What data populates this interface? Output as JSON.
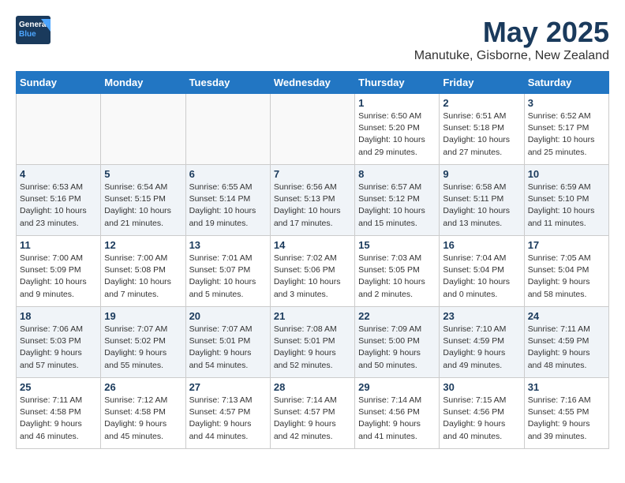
{
  "header": {
    "logo_general": "General",
    "logo_blue": "Blue",
    "month_title": "May 2025",
    "location": "Manutuke, Gisborne, New Zealand"
  },
  "weekdays": [
    "Sunday",
    "Monday",
    "Tuesday",
    "Wednesday",
    "Thursday",
    "Friday",
    "Saturday"
  ],
  "weeks": [
    [
      {
        "day": "",
        "info": ""
      },
      {
        "day": "",
        "info": ""
      },
      {
        "day": "",
        "info": ""
      },
      {
        "day": "",
        "info": ""
      },
      {
        "day": "1",
        "info": "Sunrise: 6:50 AM\nSunset: 5:20 PM\nDaylight: 10 hours\nand 29 minutes."
      },
      {
        "day": "2",
        "info": "Sunrise: 6:51 AM\nSunset: 5:18 PM\nDaylight: 10 hours\nand 27 minutes."
      },
      {
        "day": "3",
        "info": "Sunrise: 6:52 AM\nSunset: 5:17 PM\nDaylight: 10 hours\nand 25 minutes."
      }
    ],
    [
      {
        "day": "4",
        "info": "Sunrise: 6:53 AM\nSunset: 5:16 PM\nDaylight: 10 hours\nand 23 minutes."
      },
      {
        "day": "5",
        "info": "Sunrise: 6:54 AM\nSunset: 5:15 PM\nDaylight: 10 hours\nand 21 minutes."
      },
      {
        "day": "6",
        "info": "Sunrise: 6:55 AM\nSunset: 5:14 PM\nDaylight: 10 hours\nand 19 minutes."
      },
      {
        "day": "7",
        "info": "Sunrise: 6:56 AM\nSunset: 5:13 PM\nDaylight: 10 hours\nand 17 minutes."
      },
      {
        "day": "8",
        "info": "Sunrise: 6:57 AM\nSunset: 5:12 PM\nDaylight: 10 hours\nand 15 minutes."
      },
      {
        "day": "9",
        "info": "Sunrise: 6:58 AM\nSunset: 5:11 PM\nDaylight: 10 hours\nand 13 minutes."
      },
      {
        "day": "10",
        "info": "Sunrise: 6:59 AM\nSunset: 5:10 PM\nDaylight: 10 hours\nand 11 minutes."
      }
    ],
    [
      {
        "day": "11",
        "info": "Sunrise: 7:00 AM\nSunset: 5:09 PM\nDaylight: 10 hours\nand 9 minutes."
      },
      {
        "day": "12",
        "info": "Sunrise: 7:00 AM\nSunset: 5:08 PM\nDaylight: 10 hours\nand 7 minutes."
      },
      {
        "day": "13",
        "info": "Sunrise: 7:01 AM\nSunset: 5:07 PM\nDaylight: 10 hours\nand 5 minutes."
      },
      {
        "day": "14",
        "info": "Sunrise: 7:02 AM\nSunset: 5:06 PM\nDaylight: 10 hours\nand 3 minutes."
      },
      {
        "day": "15",
        "info": "Sunrise: 7:03 AM\nSunset: 5:05 PM\nDaylight: 10 hours\nand 2 minutes."
      },
      {
        "day": "16",
        "info": "Sunrise: 7:04 AM\nSunset: 5:04 PM\nDaylight: 10 hours\nand 0 minutes."
      },
      {
        "day": "17",
        "info": "Sunrise: 7:05 AM\nSunset: 5:04 PM\nDaylight: 9 hours\nand 58 minutes."
      }
    ],
    [
      {
        "day": "18",
        "info": "Sunrise: 7:06 AM\nSunset: 5:03 PM\nDaylight: 9 hours\nand 57 minutes."
      },
      {
        "day": "19",
        "info": "Sunrise: 7:07 AM\nSunset: 5:02 PM\nDaylight: 9 hours\nand 55 minutes."
      },
      {
        "day": "20",
        "info": "Sunrise: 7:07 AM\nSunset: 5:01 PM\nDaylight: 9 hours\nand 54 minutes."
      },
      {
        "day": "21",
        "info": "Sunrise: 7:08 AM\nSunset: 5:01 PM\nDaylight: 9 hours\nand 52 minutes."
      },
      {
        "day": "22",
        "info": "Sunrise: 7:09 AM\nSunset: 5:00 PM\nDaylight: 9 hours\nand 50 minutes."
      },
      {
        "day": "23",
        "info": "Sunrise: 7:10 AM\nSunset: 4:59 PM\nDaylight: 9 hours\nand 49 minutes."
      },
      {
        "day": "24",
        "info": "Sunrise: 7:11 AM\nSunset: 4:59 PM\nDaylight: 9 hours\nand 48 minutes."
      }
    ],
    [
      {
        "day": "25",
        "info": "Sunrise: 7:11 AM\nSunset: 4:58 PM\nDaylight: 9 hours\nand 46 minutes."
      },
      {
        "day": "26",
        "info": "Sunrise: 7:12 AM\nSunset: 4:58 PM\nDaylight: 9 hours\nand 45 minutes."
      },
      {
        "day": "27",
        "info": "Sunrise: 7:13 AM\nSunset: 4:57 PM\nDaylight: 9 hours\nand 44 minutes."
      },
      {
        "day": "28",
        "info": "Sunrise: 7:14 AM\nSunset: 4:57 PM\nDaylight: 9 hours\nand 42 minutes."
      },
      {
        "day": "29",
        "info": "Sunrise: 7:14 AM\nSunset: 4:56 PM\nDaylight: 9 hours\nand 41 minutes."
      },
      {
        "day": "30",
        "info": "Sunrise: 7:15 AM\nSunset: 4:56 PM\nDaylight: 9 hours\nand 40 minutes."
      },
      {
        "day": "31",
        "info": "Sunrise: 7:16 AM\nSunset: 4:55 PM\nDaylight: 9 hours\nand 39 minutes."
      }
    ]
  ]
}
